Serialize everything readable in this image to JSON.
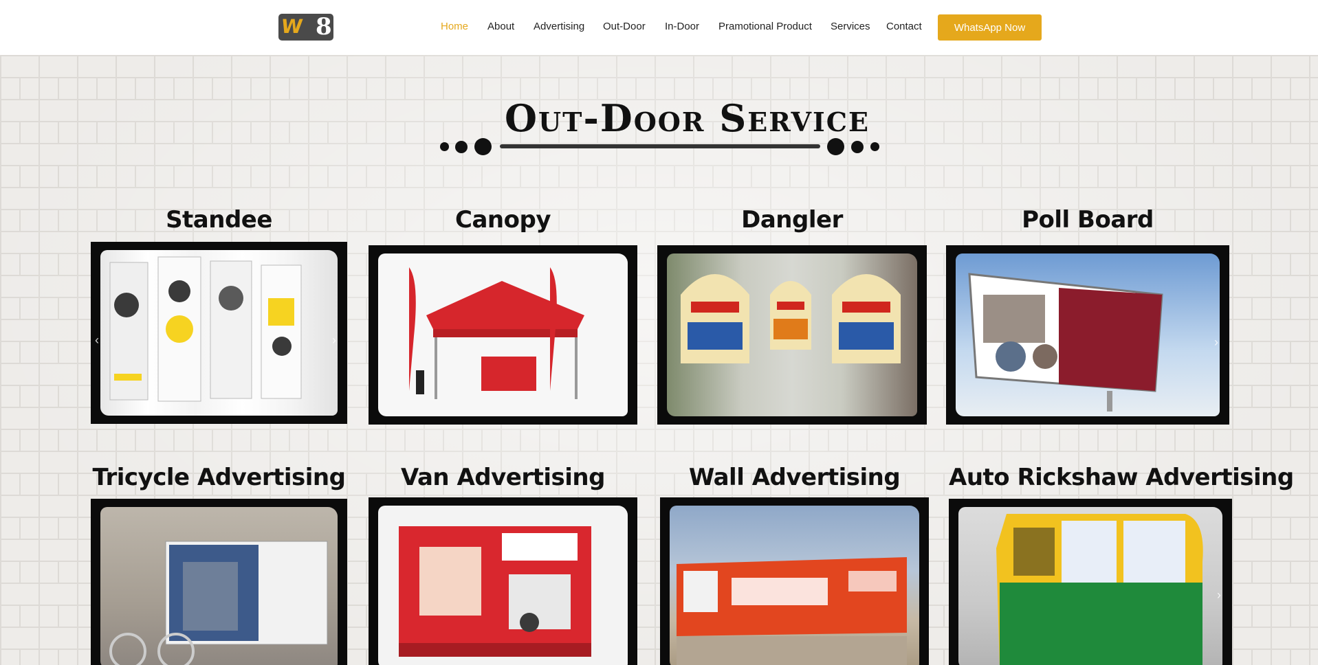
{
  "header": {
    "logo_text": "W8",
    "nav": [
      {
        "label": "Home",
        "active": true
      },
      {
        "label": "About",
        "active": false
      },
      {
        "label": "Advertising",
        "active": false
      },
      {
        "label": "Out-Door",
        "active": false
      },
      {
        "label": "In-Door",
        "active": false
      },
      {
        "label": "Pramotional Product",
        "active": false
      },
      {
        "label": "Services",
        "active": false
      },
      {
        "label": "Contact",
        "active": false
      }
    ],
    "whatsapp_label": "WhatsApp Now"
  },
  "section": {
    "title": "Out-Door Service"
  },
  "cards": [
    {
      "title": "Standee",
      "image": "standee-banners-photo",
      "colors": [
        "#f4f4f4",
        "#f6d321",
        "#2b2b2b"
      ]
    },
    {
      "title": "Canopy",
      "image": "canopy-tent-photo",
      "colors": [
        "#ffffff",
        "#d6262c",
        "#9c1b1f"
      ]
    },
    {
      "title": "Dangler",
      "image": "dangler-photo",
      "colors": [
        "#cfd4cf",
        "#f2e3b0",
        "#d0271e"
      ]
    },
    {
      "title": "Poll Board",
      "image": "poll-board-photo",
      "colors": [
        "#7fa9dc",
        "#d9e6f4",
        "#8b1c2c"
      ]
    },
    {
      "title": "Tricycle Advertising",
      "image": "tricycle-photo",
      "colors": [
        "#b7b0a6",
        "#e9e9e9",
        "#3d5a8a"
      ]
    },
    {
      "title": "Van Advertising",
      "image": "van-photo",
      "colors": [
        "#f2f2f2",
        "#d9272e",
        "#3a3a3a"
      ]
    },
    {
      "title": "Wall Advertising",
      "image": "wall-painting-photo",
      "colors": [
        "#8fa8c8",
        "#e2461f",
        "#b2a695"
      ]
    },
    {
      "title": "Auto Rickshaw Advertising",
      "image": "auto-rickshaw-photo",
      "colors": [
        "#e8e8e8",
        "#f2c21f",
        "#1f8a3b"
      ]
    }
  ],
  "colors": {
    "accent": "#e5a81c",
    "text": "#222222",
    "frame": "#0b0b0b"
  }
}
